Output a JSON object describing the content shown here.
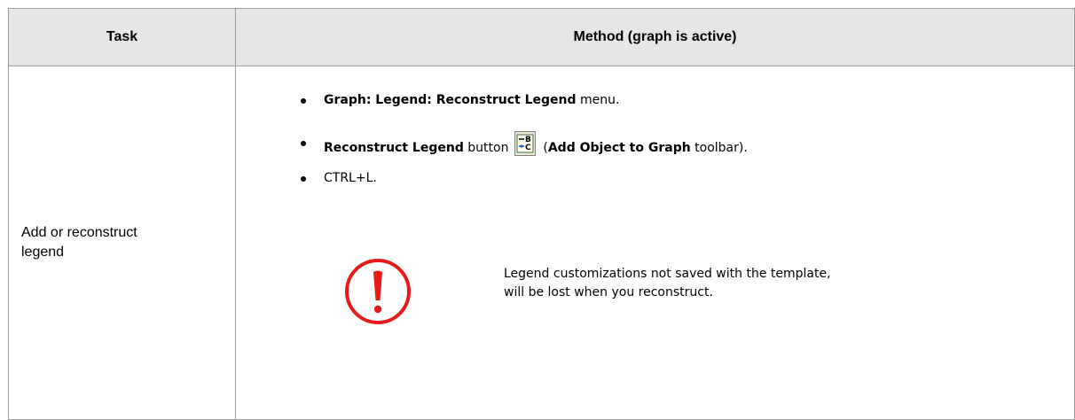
{
  "table": {
    "header": {
      "task": "Task",
      "method": "Method (graph is active)"
    },
    "row": {
      "task_line1": "Add or reconstruct",
      "task_line2": "legend",
      "methods": [
        {
          "bold": "Graph: Legend: Reconstruct Legend",
          "rest": " menu."
        },
        {
          "bold": "Reconstruct Legend",
          "mid": " button ",
          "paren_open": " (",
          "bold2": "Add Object to Graph",
          "rest": " toolbar)."
        },
        {
          "text": "CTRL+L."
        }
      ],
      "toolbar_icon": {
        "name": "reconstruct-legend-icon",
        "glyph_top": "-B",
        "glyph_bottom": "•C"
      },
      "note": {
        "icon": "exclamation-circle-icon",
        "color": "#e81b1b",
        "line1": "Legend customizations not saved with the template,",
        "line2": "will be lost when you reconstruct."
      }
    }
  }
}
